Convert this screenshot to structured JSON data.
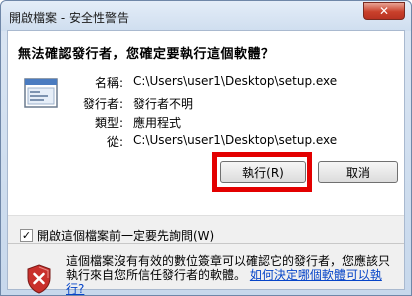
{
  "window": {
    "title": "開啟檔案 - 安全性警告",
    "close_label": "✕"
  },
  "question": "無法確認發行者，您確定要執行這個軟體？",
  "info": [
    {
      "label": "名稱:",
      "value": "C:\\Users\\user1\\Desktop\\setup.exe"
    },
    {
      "label": "發行者:",
      "value": "發行者不明"
    },
    {
      "label": "類型:",
      "value": "應用程式"
    },
    {
      "label": "從:",
      "value": "C:\\Users\\user1\\Desktop\\setup.exe"
    }
  ],
  "buttons": {
    "run": "執行(R)",
    "cancel": "取消"
  },
  "checkbox": {
    "label": "開啟這個檔案前一定要先詢問(W)",
    "checked": true,
    "check_glyph": "✓"
  },
  "warning": {
    "text": "這個檔案沒有有效的數位簽章可以確認它的發行者，您應該只執行來自您所信任發行者的軟體。",
    "link": "如何決定哪個軟體可以執行?"
  },
  "colors": {
    "highlight": "#e30000",
    "link": "#0645c8",
    "shield_red": "#c9302c"
  }
}
